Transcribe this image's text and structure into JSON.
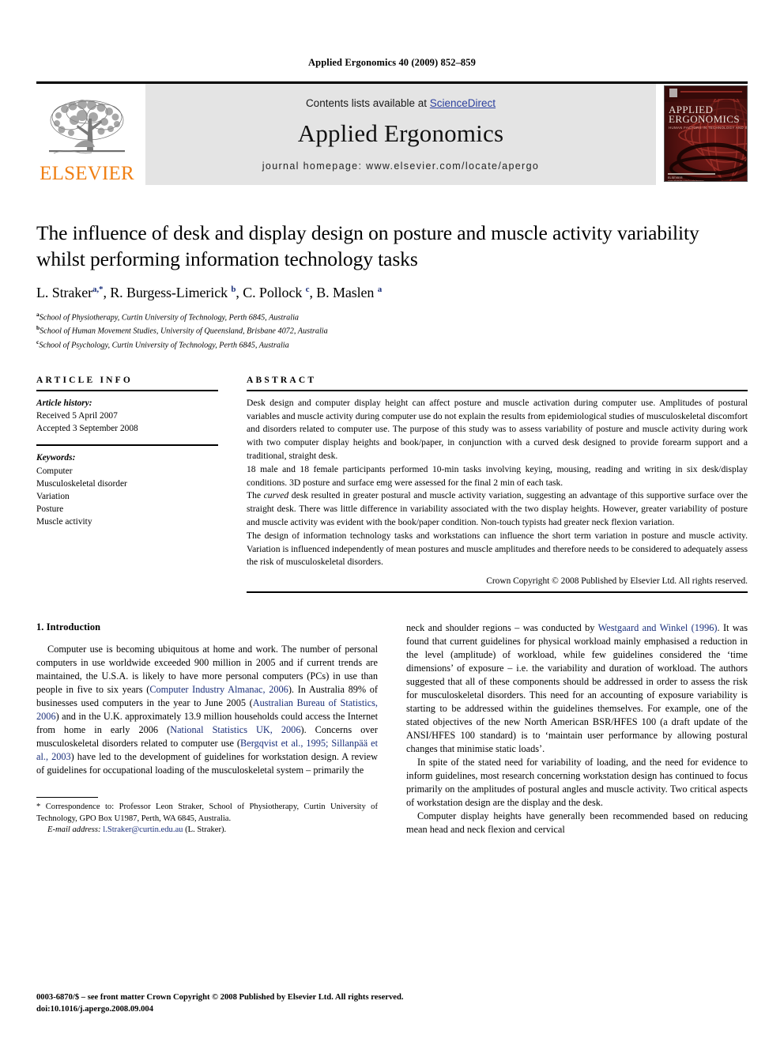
{
  "running_head": "Applied Ergonomics 40 (2009) 852–859",
  "masthead": {
    "publisher_name": "ELSEVIER",
    "contents_prefix": "Contents lists available at ",
    "sciencedirect": "ScienceDirect",
    "journal_title": "Applied Ergonomics",
    "homepage": "journal homepage: www.elsevier.com/locate/apergo",
    "cover_line1": "APPLIED",
    "cover_line2": "ERGONOMICS",
    "cover_subtitle": "HUMAN FACTORS IN TECHNOLOGY AND SOCIETY",
    "cover_footer": "ELSEVIER",
    "accent_orange": "#f07f13",
    "link_blue": "#2b3f9e",
    "banner_gray": "#e4e4e4",
    "cover_maroon": "#5d1412"
  },
  "article": {
    "title": "The influence of desk and display design on posture and muscle activity variability whilst performing information technology tasks",
    "authors_html": "L. Straker<sup>a,*</sup>, R. Burgess-Limerick <sup>b</sup>, C. Pollock <sup>c</sup>, B. Maslen <sup>a</sup>",
    "affiliations": [
      {
        "mark": "a",
        "text": "School of Physiotherapy, Curtin University of Technology, Perth 6845, Australia"
      },
      {
        "mark": "b",
        "text": "School of Human Movement Studies, University of Queensland, Brisbane 4072, Australia"
      },
      {
        "mark": "c",
        "text": "School of Psychology, Curtin University of Technology, Perth 6845, Australia"
      }
    ]
  },
  "article_info": {
    "heading": "ARTICLE INFO",
    "history_label": "Article history:",
    "received": "Received 5 April 2007",
    "accepted": "Accepted 3 September 2008",
    "keywords_label": "Keywords:",
    "keywords": [
      "Computer",
      "Musculoskeletal disorder",
      "Variation",
      "Posture",
      "Muscle activity"
    ]
  },
  "abstract": {
    "heading": "ABSTRACT",
    "paragraph1": "Desk design and computer display height can affect posture and muscle activation during computer use. Amplitudes of postural variables and muscle activity during computer use do not explain the results from epidemiological studies of musculoskeletal discomfort and disorders related to computer use. The purpose of this study was to assess variability of posture and muscle activity during work with two computer display heights and book/paper, in conjunction with a curved desk designed to provide forearm support and a traditional, straight desk.",
    "paragraph2": "18 male and 18 female participants performed 10-min tasks involving keying, mousing, reading and writing in six desk/display conditions. 3D posture and surface emg were assessed for the final 2 min of each task.",
    "paragraph3_pre": "The ",
    "paragraph3_em": "curved",
    "paragraph3_post": " desk resulted in greater postural and muscle activity variation, suggesting an advantage of this supportive surface over the straight desk. There was little difference in variability associated with the two display heights. However, greater variability of posture and muscle activity was evident with the book/paper condition. Non-touch typists had greater neck flexion variation.",
    "paragraph4": "The design of information technology tasks and workstations can influence the short term variation in posture and muscle activity. Variation is influenced independently of mean postures and muscle amplitudes and therefore needs to be considered to adequately assess the risk of musculoskeletal disorders.",
    "copyright": "Crown Copyright © 2008 Published by Elsevier Ltd. All rights reserved."
  },
  "introduction": {
    "section_title": "1. Introduction",
    "left_p1_a": "Computer use is becoming ubiquitous at home and work. The number of personal computers in use worldwide exceeded 900 million in 2005 and if current trends are maintained, the U.S.A. is likely to have more personal computers (PCs) in use than people in five to six years (",
    "left_ref1": "Computer Industry Almanac, 2006",
    "left_p1_b": "). In Australia 89% of businesses used computers in the year to June 2005 (",
    "left_ref2": "Australian Bureau of Statistics, 2006",
    "left_p1_c": ") and in the U.K. approximately 13.9 million households could access the Internet from home in early 2006 (",
    "left_ref3": "National Statistics UK, 2006",
    "left_p1_d": "). Concerns over musculoskeletal disorders related to computer use (",
    "left_ref4": "Bergqvist et al., 1995; Sillanpää et al., 2003",
    "left_p1_e": ") have led to the development of guidelines for workstation design. A review of guidelines for occupational loading of the musculoskeletal system – primarily the",
    "right_p1_a": "neck and shoulder regions – was conducted by ",
    "right_ref1": "Westgaard and Winkel (1996)",
    "right_p1_b": ". It was found that current guidelines for physical workload mainly emphasised a reduction in the level (amplitude) of workload, while few guidelines considered the ‘time dimensions’ of exposure – i.e. the variability and duration of workload. The authors suggested that all of these components should be addressed in order to assess the risk for musculoskeletal disorders. This need for an accounting of exposure variability is starting to be addressed within the guidelines themselves. For example, one of the stated objectives of the new North American BSR/HFES 100 (a draft update of the ANSI/HFES 100 standard) is to ‘maintain user performance by allowing postural changes that minimise static loads’.",
    "right_p2": "In spite of the stated need for variability of loading, and the need for evidence to inform guidelines, most research concerning workstation design has continued to focus primarily on the amplitudes of postural angles and muscle activity. Two critical aspects of workstation design are the display and the desk.",
    "right_p3": "Computer display heights have generally been recommended based on reducing mean head and neck flexion and cervical"
  },
  "footnote": {
    "correspondence": "* Correspondence to: Professor Leon Straker, School of Physiotherapy, Curtin University of Technology, GPO Box U1987, Perth, WA 6845, Australia.",
    "email_label": "E-mail address:",
    "email": "l.Straker@curtin.edu.au",
    "email_suffix": "(L. Straker)."
  },
  "page_footer": {
    "line1": "0003-6870/$ – see front matter Crown Copyright © 2008 Published by Elsevier Ltd. All rights reserved.",
    "line2": "doi:10.1016/j.apergo.2008.09.004"
  }
}
